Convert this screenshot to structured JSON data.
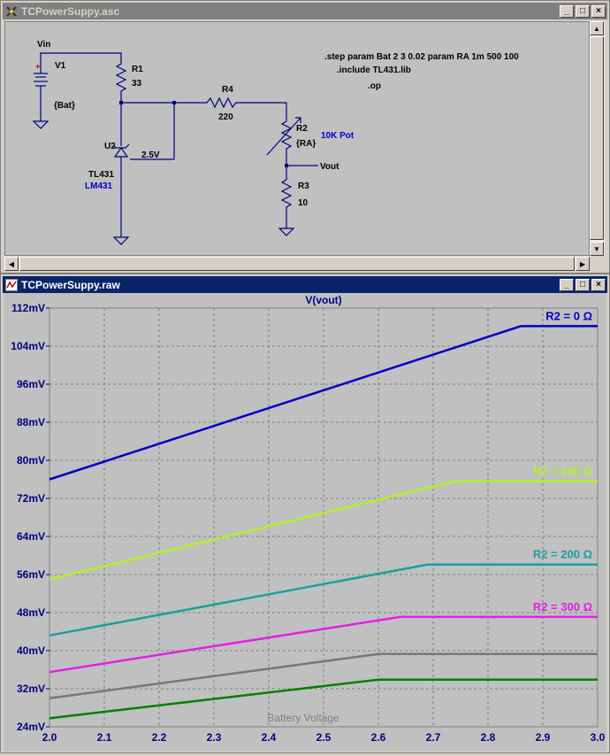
{
  "schematic_window": {
    "title": "TCPowerSuppy.asc",
    "buttons": [
      "_",
      "□",
      "×"
    ],
    "directives": [
      ".step param Bat 2 3 0.02 param RA 1m 500 100",
      ".include TL431.lib",
      ".op"
    ],
    "labels": {
      "vin": "Vin",
      "v1": "V1",
      "v1_value": "{Bat}",
      "plus": "+",
      "r1": "R1",
      "r1_value": "33",
      "r4": "R4",
      "r4_value": "220",
      "r2": "R2",
      "r2_value": "{RA}",
      "r2_note": "10K Pot",
      "u2": "U2",
      "u2_model": "TL431",
      "u2_sub": "LM431",
      "ref_voltage": "2.5V",
      "vout": "Vout",
      "r3": "R3",
      "r3_value": "10"
    }
  },
  "plot_window": {
    "title": "TCPowerSuppy.raw",
    "buttons": [
      "_",
      "□",
      "×"
    ]
  },
  "colors": {
    "trace_blue": "#0000c8",
    "trace_lime": "#b4f028",
    "trace_teal": "#1aa0a0",
    "trace_magenta": "#e61ee6",
    "trace_gray": "#787878",
    "trace_green": "#008000",
    "axis_text": "#000080"
  },
  "chart_data": {
    "type": "line",
    "title": "V(vout)",
    "xlabel": "Battery Voltage",
    "ylabel": "",
    "xlim": [
      2.0,
      3.0
    ],
    "ylim": [
      24,
      112
    ],
    "x_ticks": [
      "2.0",
      "2.1",
      "2.2",
      "2.3",
      "2.4",
      "2.5",
      "2.6",
      "2.7",
      "2.8",
      "2.9",
      "3.0"
    ],
    "y_ticks": [
      "24mV",
      "32mV",
      "40mV",
      "48mV",
      "56mV",
      "64mV",
      "72mV",
      "80mV",
      "88mV",
      "96mV",
      "104mV",
      "112mV"
    ],
    "y_tick_values": [
      24,
      32,
      40,
      48,
      56,
      64,
      72,
      80,
      88,
      96,
      104,
      112
    ],
    "grid": true,
    "series": [
      {
        "name": "R2 = 0 Ω",
        "color": "#0000c8",
        "x": [
          2.0,
          2.86,
          3.0
        ],
        "y": [
          76.0,
          108.2,
          108.2
        ]
      },
      {
        "name": "R2 = 100 Ω",
        "color": "#b4f028",
        "x": [
          2.0,
          2.74,
          3.0
        ],
        "y": [
          55.0,
          75.6,
          75.6
        ]
      },
      {
        "name": "R2 = 200 Ω",
        "color": "#1aa0a0",
        "x": [
          2.0,
          2.69,
          3.0
        ],
        "y": [
          43.2,
          58.1,
          58.1
        ]
      },
      {
        "name": "R2 = 300 Ω",
        "color": "#e61ee6",
        "x": [
          2.0,
          2.64,
          3.0
        ],
        "y": [
          35.5,
          47.1,
          47.1
        ]
      },
      {
        "name": "",
        "color": "#787878",
        "x": [
          2.0,
          2.6,
          3.0
        ],
        "y": [
          30.0,
          39.3,
          39.3
        ]
      },
      {
        "name": "",
        "color": "#008000",
        "x": [
          2.0,
          2.6,
          3.0
        ],
        "y": [
          25.8,
          33.9,
          33.9
        ]
      }
    ]
  }
}
